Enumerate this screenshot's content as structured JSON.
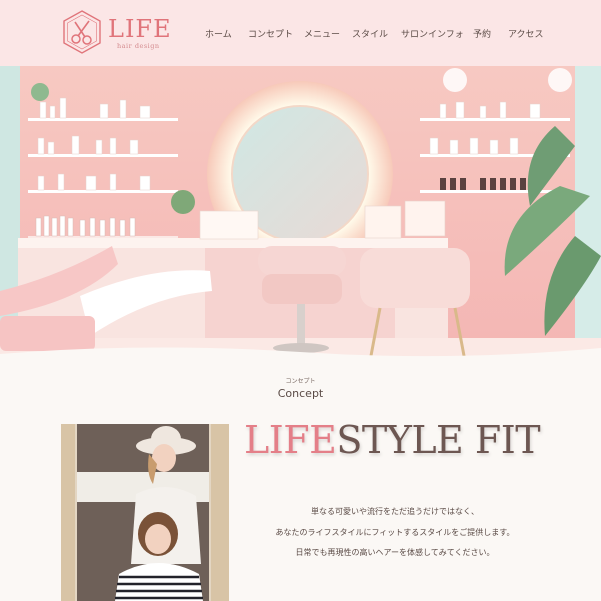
{
  "header": {
    "logo_text": "LIFE",
    "logo_sub": "hair design",
    "nav": [
      "ホーム",
      "コンセプト",
      "メニュー",
      "スタイル",
      "サロンインフォ",
      "予約",
      "アクセス"
    ]
  },
  "concept": {
    "small_label": "コンセプト",
    "title": "Concept",
    "headline_accent": "LIFE",
    "headline_rest": "STYLE FIT",
    "body": [
      "単なる可愛いや流行をただ追うだけではなく、",
      "あなたのライフスタイルにフィットするスタイルをご提供します。",
      "日常でも再現性の高いヘアーを体感してみてください。"
    ]
  },
  "colors": {
    "header_bg": "#fbe6e6",
    "brand": "#e0747a",
    "page_bg": "#fbf8f5"
  }
}
